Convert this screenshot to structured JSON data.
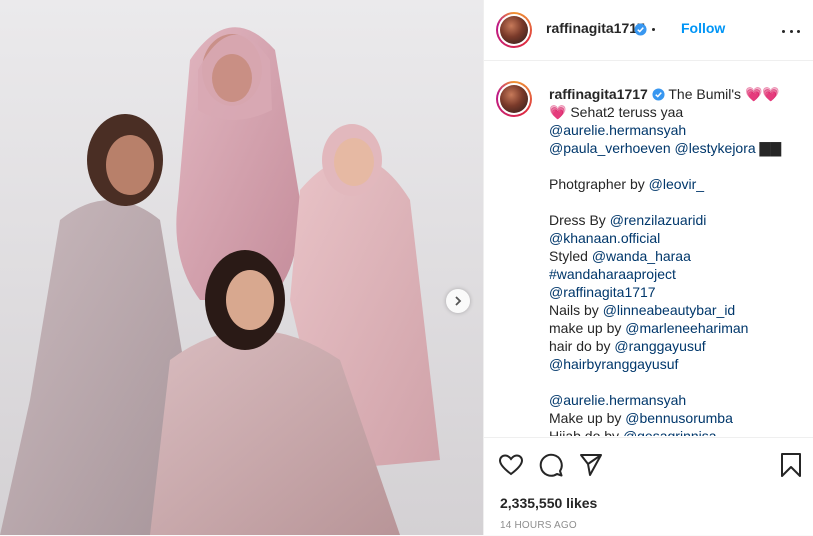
{
  "post": {
    "username": "raffinagita1717",
    "follow_label": "Follow",
    "likes": "2,335,550 likes",
    "timestamp": "14 HOURS AGO"
  },
  "caption": {
    "lines": [
      [
        {
          "t": "raffinagita1717",
          "k": "user"
        },
        {
          "t": " ",
          "k": "sp"
        },
        {
          "t": "✔",
          "k": "badge"
        },
        {
          "t": " The Bumil's ",
          "k": "text"
        },
        {
          "t": "💗💗",
          "k": "heart"
        }
      ],
      [
        {
          "t": "💗",
          "k": "heart"
        },
        {
          "t": " Sehat2 teruss yaa",
          "k": "text"
        }
      ],
      [
        {
          "t": "@aurelie.hermansyah",
          "k": "mention"
        }
      ],
      [
        {
          "t": "@paula_verhoeven",
          "k": "mention"
        },
        {
          "t": " ",
          "k": "text"
        },
        {
          "t": "@lestykejora",
          "k": "mention"
        },
        {
          "t": " ▇▇",
          "k": "text"
        }
      ],
      [
        {
          "t": "",
          "k": "text"
        }
      ],
      [
        {
          "t": "Photgrapher by ",
          "k": "text"
        },
        {
          "t": "@leovir_",
          "k": "mention"
        }
      ],
      [
        {
          "t": "",
          "k": "text"
        }
      ],
      [
        {
          "t": "Dress By ",
          "k": "text"
        },
        {
          "t": "@renzilazuaridi",
          "k": "mention"
        }
      ],
      [
        {
          "t": "@khanaan.official",
          "k": "mention"
        }
      ],
      [
        {
          "t": "Styled ",
          "k": "text"
        },
        {
          "t": "@wanda_haraa",
          "k": "mention"
        }
      ],
      [
        {
          "t": "#wandaharaaproject",
          "k": "mention"
        }
      ],
      [
        {
          "t": "@raffinagita1717",
          "k": "mention"
        }
      ],
      [
        {
          "t": "Nails by ",
          "k": "text"
        },
        {
          "t": "@linneabeautybar_id",
          "k": "mention"
        }
      ],
      [
        {
          "t": "make up by ",
          "k": "text"
        },
        {
          "t": "@marleneehariman",
          "k": "mention"
        }
      ],
      [
        {
          "t": "hair do by ",
          "k": "text"
        },
        {
          "t": "@ranggayusuf",
          "k": "mention"
        }
      ],
      [
        {
          "t": "@hairbyranggayusuf",
          "k": "mention"
        }
      ],
      [
        {
          "t": "",
          "k": "text"
        }
      ],
      [
        {
          "t": "@aurelie.hermansyah",
          "k": "mention"
        }
      ],
      [
        {
          "t": "Make up by ",
          "k": "text"
        },
        {
          "t": "@bennusorumba",
          "k": "mention"
        }
      ],
      [
        {
          "t": "Hijab do by ",
          "k": "text"
        },
        {
          "t": "@gesagrinnisa",
          "k": "mention"
        }
      ]
    ]
  },
  "icons": {
    "like": "heart-outline-icon",
    "comment": "comment-bubble-icon",
    "share": "paper-plane-icon",
    "save": "bookmark-icon",
    "more": "more-options-icon",
    "next": "chevron-right-icon"
  },
  "colors": {
    "link": "#00376b",
    "follow": "#0095f6",
    "verified": "#3897f0"
  }
}
